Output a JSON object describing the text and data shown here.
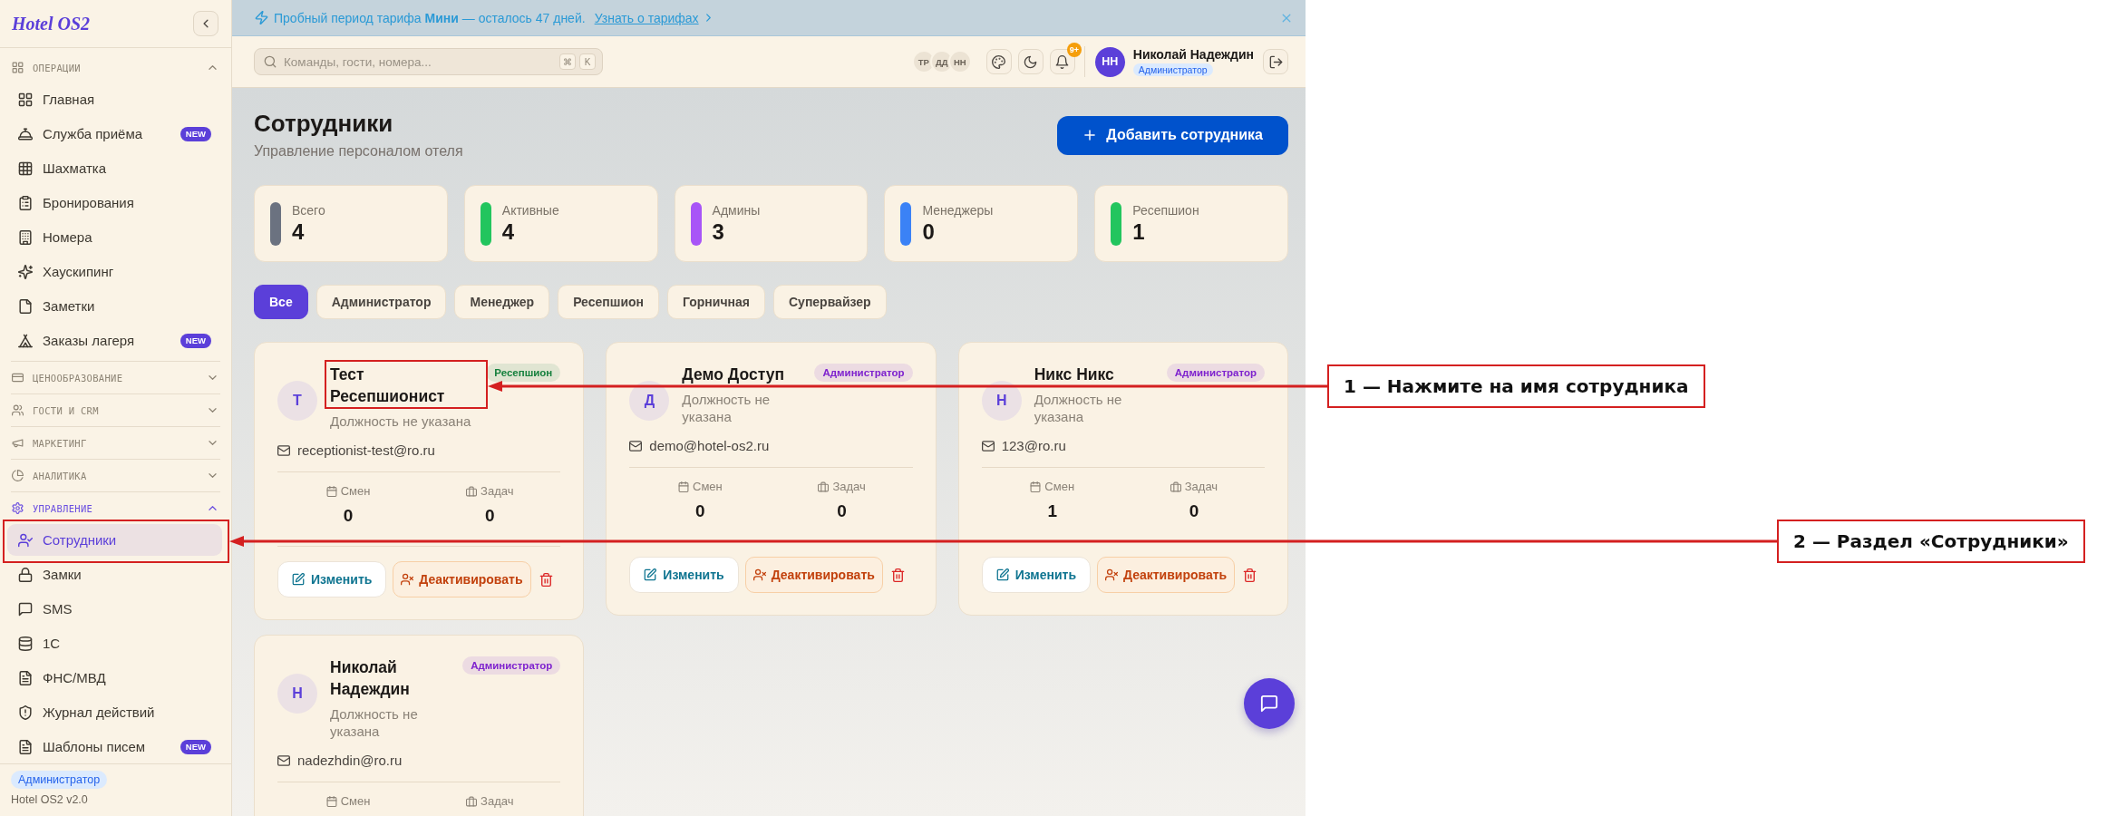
{
  "sidebar": {
    "logo": "Hotel OS2",
    "sections": [
      {
        "title": "ОПЕРАЦИИ",
        "expanded": true,
        "items": [
          {
            "label": "Главная",
            "selected": false
          },
          {
            "label": "Служба приёма",
            "selected": false,
            "badge": "NEW"
          },
          {
            "label": "Шахматка",
            "selected": false
          },
          {
            "label": "Бронирования",
            "selected": false
          },
          {
            "label": "Номера",
            "selected": false
          },
          {
            "label": "Хаускипинг",
            "selected": false
          },
          {
            "label": "Заметки",
            "selected": false
          },
          {
            "label": "Заказы лагеря",
            "selected": false,
            "badge": "NEW"
          }
        ]
      },
      {
        "title": "ЦЕНООБРАЗОВАНИЕ",
        "expanded": false
      },
      {
        "title": "ГОСТИ И CRM",
        "expanded": false
      },
      {
        "title": "МАРКЕТИНГ",
        "expanded": false
      },
      {
        "title": "АНАЛИТИКА",
        "expanded": false
      },
      {
        "title": "УПРАВЛЕНИЕ",
        "expanded": true,
        "items": [
          {
            "label": "Сотрудники",
            "selected": true
          },
          {
            "label": "Замки",
            "selected": false
          },
          {
            "label": "SMS",
            "selected": false
          },
          {
            "label": "1С",
            "selected": false
          },
          {
            "label": "ФНС/МВД",
            "selected": false
          },
          {
            "label": "Журнал действий",
            "selected": false
          },
          {
            "label": "Шаблоны писем",
            "selected": false,
            "badge": "NEW"
          }
        ]
      }
    ],
    "footer": {
      "role": "Администратор",
      "version": "Hotel OS2 v2.0"
    }
  },
  "banner": {
    "message": "Пробный период тарифа **Мини** — осталось 47 дней.",
    "link": "Узнать о тарифах"
  },
  "topbar": {
    "search": {
      "placeholder": "Команды, гости, номера...",
      "keys": [
        "⌘",
        "K"
      ]
    },
    "online_users": [
      "ТР",
      "ДД",
      "НН"
    ],
    "notification_count": "9+",
    "user": {
      "initials": "НН",
      "name": "Николай Надеждин",
      "role": "Администратор"
    }
  },
  "page": {
    "title": "Сотрудники",
    "subtitle": "Управление персоналом отеля",
    "add_button": "Добавить сотрудника"
  },
  "stats": [
    {
      "label": "Всего",
      "value": "4",
      "color": "#6b7280"
    },
    {
      "label": "Активные",
      "value": "4",
      "color": "#22c55e"
    },
    {
      "label": "Админы",
      "value": "3",
      "color": "#a855f7"
    },
    {
      "label": "Менеджеры",
      "value": "0",
      "color": "#3b82f6"
    },
    {
      "label": "Ресепшион",
      "value": "1",
      "color": "#22c55e"
    }
  ],
  "filters": [
    {
      "label": "Все",
      "selected": true
    },
    {
      "label": "Администратор",
      "selected": false
    },
    {
      "label": "Менеджер",
      "selected": false
    },
    {
      "label": "Ресепшион",
      "selected": false
    },
    {
      "label": "Горничная",
      "selected": false
    },
    {
      "label": "Супервайзер",
      "selected": false
    }
  ],
  "employees": [
    {
      "initial": "Т",
      "name": "Тест Ресепшионист",
      "position": "Должность не указана",
      "role": {
        "label": "Ресепшион",
        "color": "#15803d"
      },
      "email": "receptionist-test@ro.ru",
      "stats": [
        {
          "label": "Смен",
          "value": "0"
        },
        {
          "label": "Задач",
          "value": "0"
        }
      ],
      "actions": {
        "edit": "Изменить",
        "deactivate": "Деактивировать"
      }
    },
    {
      "initial": "Д",
      "name": "Демо Доступ",
      "position": "Должность не указана",
      "role": {
        "label": "Администратор",
        "color": "#7e22ce"
      },
      "email": "demo@hotel-os2.ru",
      "stats": [
        {
          "label": "Смен",
          "value": "0"
        },
        {
          "label": "Задач",
          "value": "0"
        }
      ],
      "actions": {
        "edit": "Изменить",
        "deactivate": "Деактивировать"
      }
    },
    {
      "initial": "Н",
      "name": "Никс Никс",
      "position": "Должность не указана",
      "role": {
        "label": "Администратор",
        "color": "#7e22ce"
      },
      "email": "123@ro.ru",
      "stats": [
        {
          "label": "Смен",
          "value": "1"
        },
        {
          "label": "Задач",
          "value": "0"
        }
      ],
      "actions": {
        "edit": "Изменить",
        "deactivate": "Деактивировать"
      }
    },
    {
      "initial": "Н",
      "name": "Николай Надеждин",
      "position": "Должность не указана",
      "role": {
        "label": "Администратор",
        "color": "#7e22ce"
      },
      "email": "nadezhdin@ro.ru",
      "stats": [
        {
          "label": "Смен"
        },
        {
          "label": "Задач"
        }
      ]
    }
  ],
  "annotations": [
    {
      "text": "1 — Нажмите на имя сотрудника"
    },
    {
      "text": "2 — Раздел «Сотрудники»"
    }
  ]
}
